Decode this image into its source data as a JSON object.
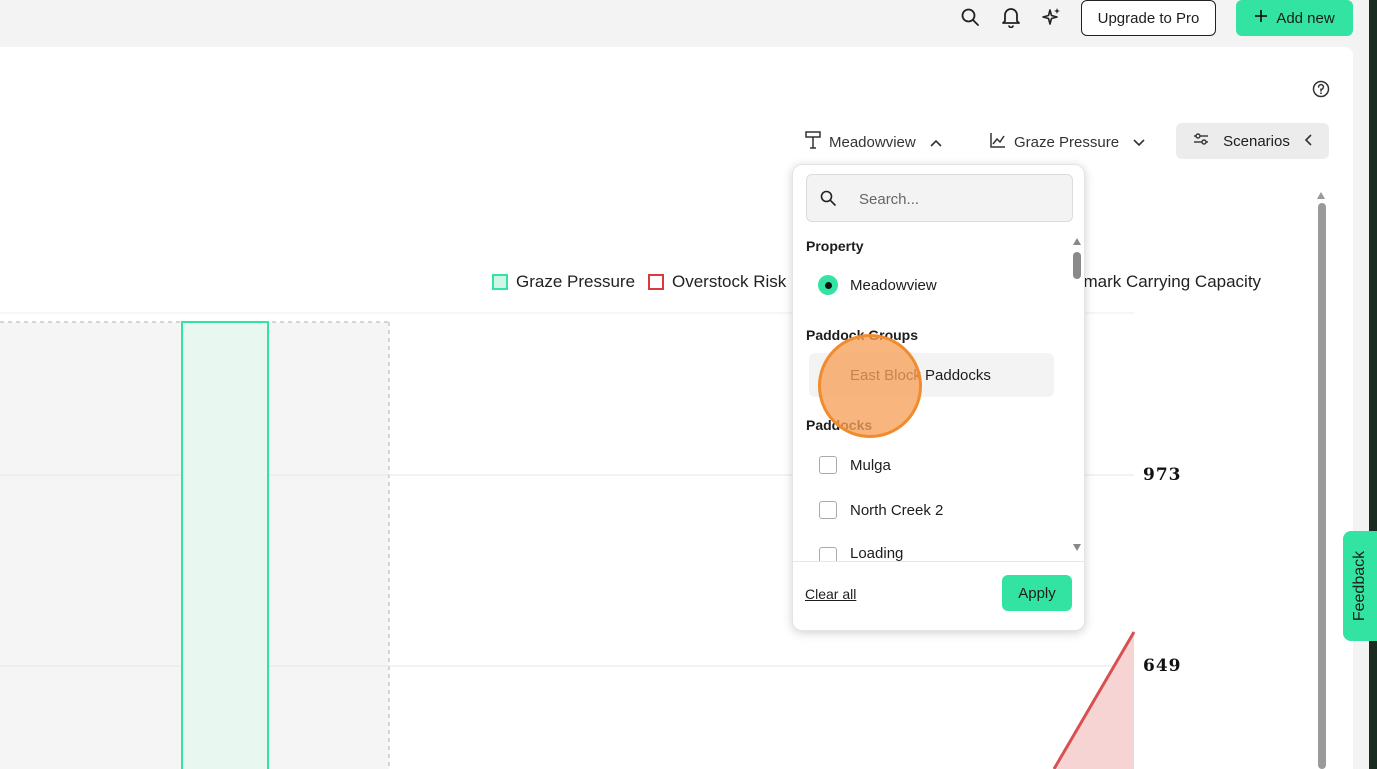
{
  "topbar": {
    "icons": [
      "search-icon",
      "bell-icon",
      "sparkles-icon"
    ],
    "upgrade_label": "Upgrade to Pro",
    "add_new_label": "Add new"
  },
  "filters": {
    "property_label": "Meadowview",
    "metric_label": "Graze Pressure",
    "scenarios_label": "Scenarios"
  },
  "legend": {
    "items": [
      {
        "label": "Graze Pressure",
        "color": "#33e3a2"
      },
      {
        "label": "Overstock Risk",
        "color": "#d93a3a"
      },
      {
        "label": "hmark Carrying Capacity"
      }
    ]
  },
  "chart_data": {
    "type": "bar",
    "y_tick_labels": [
      "973",
      "649"
    ],
    "grid": true,
    "colors": {
      "bar": "#33e3a2",
      "area": "#d95050"
    }
  },
  "dropdown": {
    "search_placeholder": "Search...",
    "property_title": "Property",
    "property_option": "Meadowview",
    "groups_title": "Paddock Groups",
    "group_option": "East Block Paddocks",
    "paddocks_title": "Paddocks",
    "paddocks": [
      "Mulga",
      "North Creek 2",
      "Loading"
    ],
    "clear_all_label": "Clear all",
    "apply_label": "Apply"
  },
  "feedback_label": "Feedback",
  "colors": {
    "accent": "#33e3a2",
    "danger": "#d93a3a"
  }
}
